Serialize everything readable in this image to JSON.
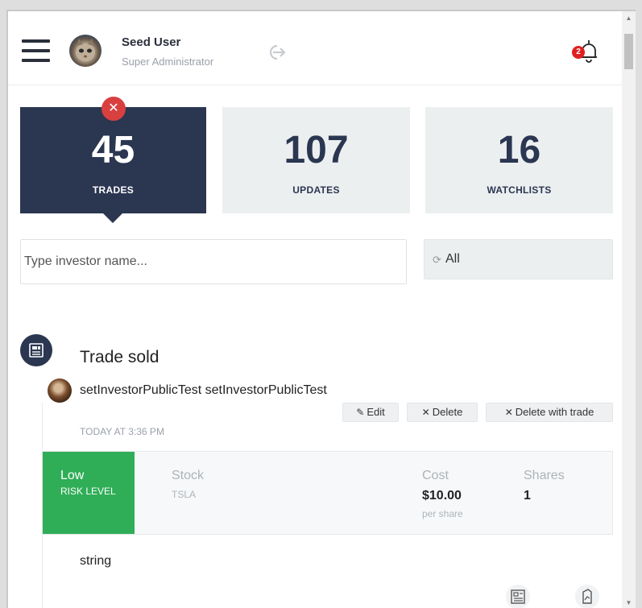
{
  "user": {
    "name": "Seed User",
    "role": "Super Administrator"
  },
  "notifications": {
    "count": "2"
  },
  "stats": [
    {
      "value": "45",
      "label": "TRADES",
      "active": true
    },
    {
      "value": "107",
      "label": "UPDATES",
      "active": false
    },
    {
      "value": "16",
      "label": "WATCHLISTS",
      "active": false
    }
  ],
  "filters": {
    "search_placeholder": "Type investor name...",
    "select_value": "All"
  },
  "trade": {
    "title": "Trade sold",
    "investor": "setInvestorPublicTest setInvestorPublicTest",
    "time": "TODAY AT 3:36 PM",
    "buttons": {
      "edit": "Edit",
      "delete": "Delete",
      "delete_with_trade": "Delete with trade"
    },
    "risk": {
      "level": "Low",
      "label": "RISK LEVEL"
    },
    "stock": {
      "label": "Stock",
      "value": "TSLA"
    },
    "cost": {
      "label": "Cost",
      "value": "$10.00",
      "unit": "per share"
    },
    "shares": {
      "label": "Shares",
      "value": "1"
    },
    "note": "string"
  },
  "colors": {
    "navy": "#2b3651",
    "green": "#2fae57",
    "red": "#d84040",
    "card": "#eceff0"
  }
}
